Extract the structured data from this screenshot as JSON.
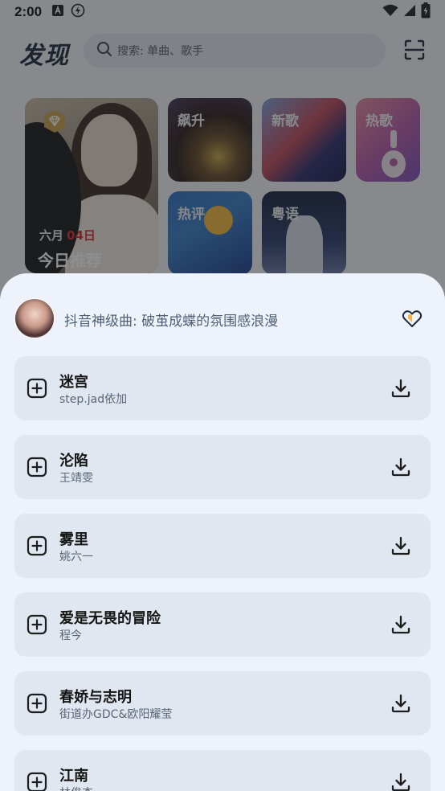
{
  "status_bar": {
    "time": "2:00"
  },
  "header": {
    "logo": "发现",
    "search_placeholder": "搜索: 单曲、歌手"
  },
  "featured": {
    "date_month": "六月",
    "date_day": "04日",
    "title": "今日推荐"
  },
  "categories": [
    {
      "label": "飙升"
    },
    {
      "label": "新歌"
    },
    {
      "label": "热歌"
    },
    {
      "label": "热评"
    },
    {
      "label": "粤语"
    }
  ],
  "sheet": {
    "playlist_title": "抖音神级曲: 破茧成蝶的氛围感浪漫",
    "songs": [
      {
        "name": "迷宫",
        "artist": "step.jad依加"
      },
      {
        "name": "沦陷",
        "artist": "王靖雯"
      },
      {
        "name": "雾里",
        "artist": "姚六一"
      },
      {
        "name": "爱是无畏的冒险",
        "artist": "程今"
      },
      {
        "name": "春娇与志明",
        "artist": "街道办GDC&欧阳耀莹"
      },
      {
        "name": "江南",
        "artist": "林俊杰"
      }
    ]
  },
  "colors": {
    "sheet_bg": "#eef3fb",
    "card_bg": "#e1e7f0",
    "text_primary": "#141414",
    "text_secondary": "#5a6573",
    "date_accent": "#d62a2a"
  }
}
